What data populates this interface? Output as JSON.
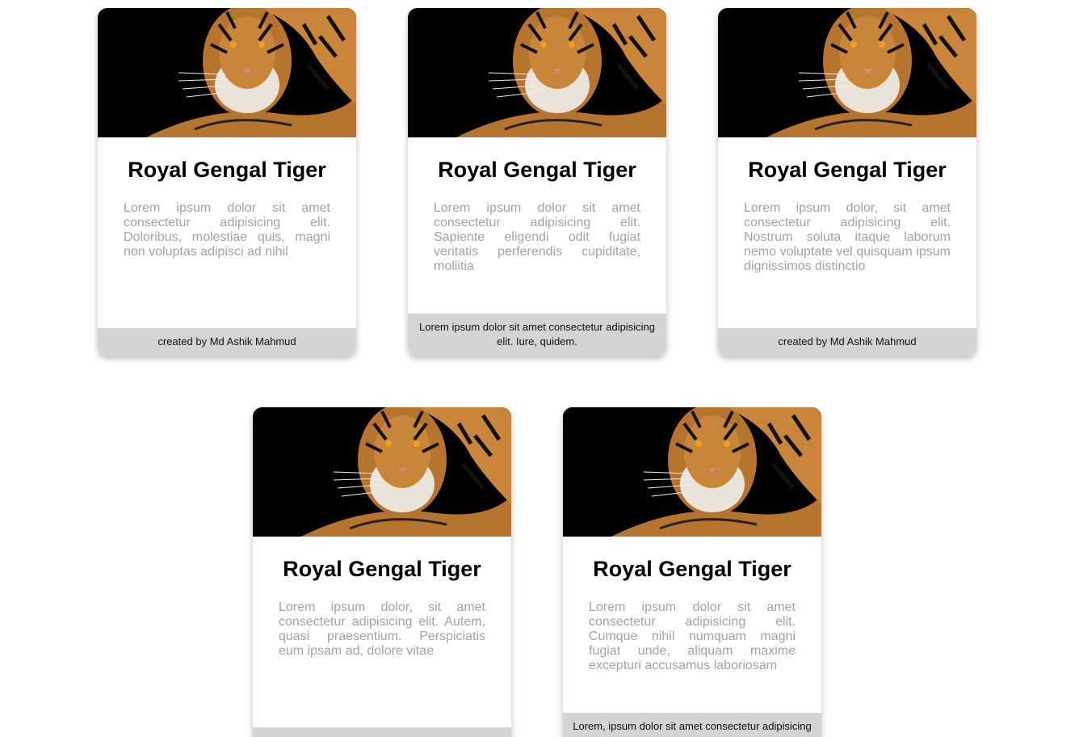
{
  "cards": [
    {
      "title": "Royal Gengal Tiger",
      "description": "Lorem ipsum dolor sit amet consectetur adipisicing elit. Doloribus, molestiae quis, magni non voluptas adipisci ad nihil",
      "footer": "created by Md Ashik Mahmud",
      "image_icon": "tiger-image"
    },
    {
      "title": "Royal Gengal Tiger",
      "description": "Lorem ipsum dolor sit amet consectetur adipisicing elit. Sapiente eligendi odit fugiat veritatis perferendis cupiditate, mollitia",
      "footer": "Lorem ipsum dolor sit amet consectetur adipisicing elit. Iure, quidem.",
      "image_icon": "tiger-image"
    },
    {
      "title": "Royal Gengal Tiger",
      "description": "Lorem ipsum dolor, sit amet consectetur adipisicing elit. Nostrum soluta itaque laborum nemo voluptate vel quisquam ipsum dignissimos distinctio",
      "footer": "created by Md Ashik Mahmud",
      "image_icon": "tiger-image"
    },
    {
      "title": "Royal Gengal Tiger",
      "description": "Lorem ipsum dolor, sit amet consectetur adipisicing elit. Autem, quasi praesentium. Perspiciatis eum ipsam ad, dolore vitae",
      "footer": "",
      "image_icon": "tiger-image"
    },
    {
      "title": "Royal Gengal Tiger",
      "description": "Lorem ipsum dolor sit amet consectetur adipisicing elit. Cumque nihil numquam magni fugiat unde, aliquam maxime excepturi accusamus laboriosam",
      "footer": "Lorem, ipsum dolor sit amet consectetur adipisicing",
      "image_icon": "tiger-image"
    }
  ],
  "colors": {
    "card_bg": "#ffffff",
    "footer_bg": "#d4d4d4",
    "desc_text": "#a3a3a3",
    "title_text": "#000000",
    "image_bg": "#000000",
    "tiger_orange": "#c9853a"
  }
}
